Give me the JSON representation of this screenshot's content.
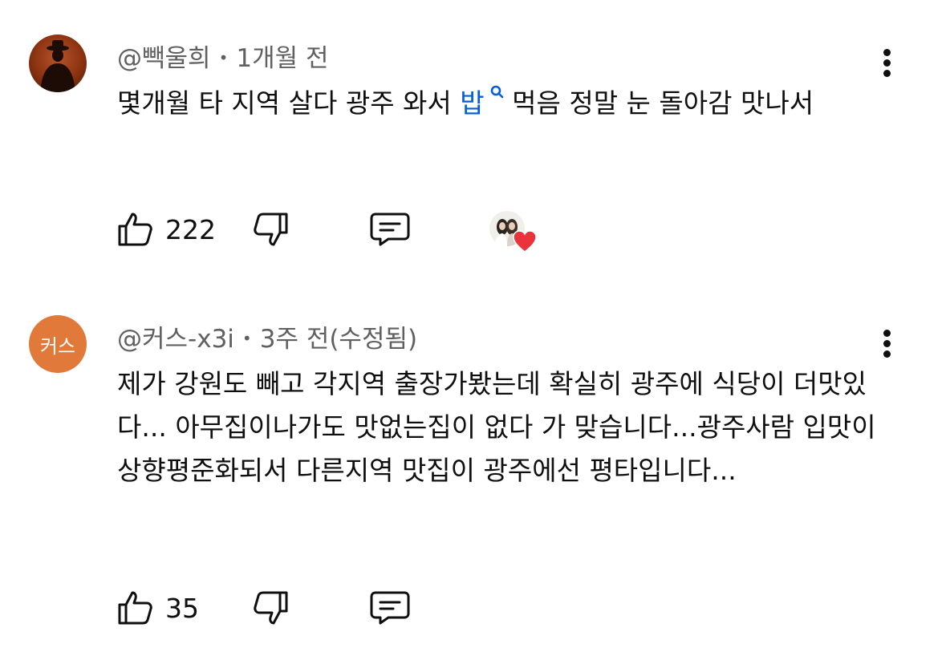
{
  "comments": [
    {
      "author": "@빽울희",
      "time": "1개월 전",
      "text_before": "몇개월 타 지역 살다 광주 와서 ",
      "search_word": "밥",
      "text_after": " 먹음 정말 눈 돌아감 맛나서",
      "likes": "222",
      "creator_heart": true,
      "avatar_icon": "user-silhouette-icon"
    },
    {
      "author": "@커스-x3i",
      "time": "3주 전(수정됨)",
      "avatar_letter": "커스",
      "avatar_color": "#e0793a",
      "text": "제가 강원도 빼고 각지역 출장가봤는데 확실히 광주에 식당이 더맛있다... 아무집이나가도 맛없는집이 없다 가 맞습니다...광주사람 입맛이 상향평준화되서 다른지역 맛집이 광주에선 평타입니다...",
      "likes": "35"
    }
  ],
  "meta_separator": "•",
  "colors": {
    "link": "#065fd4",
    "meta": "#606060",
    "heart": "#e8343a"
  }
}
